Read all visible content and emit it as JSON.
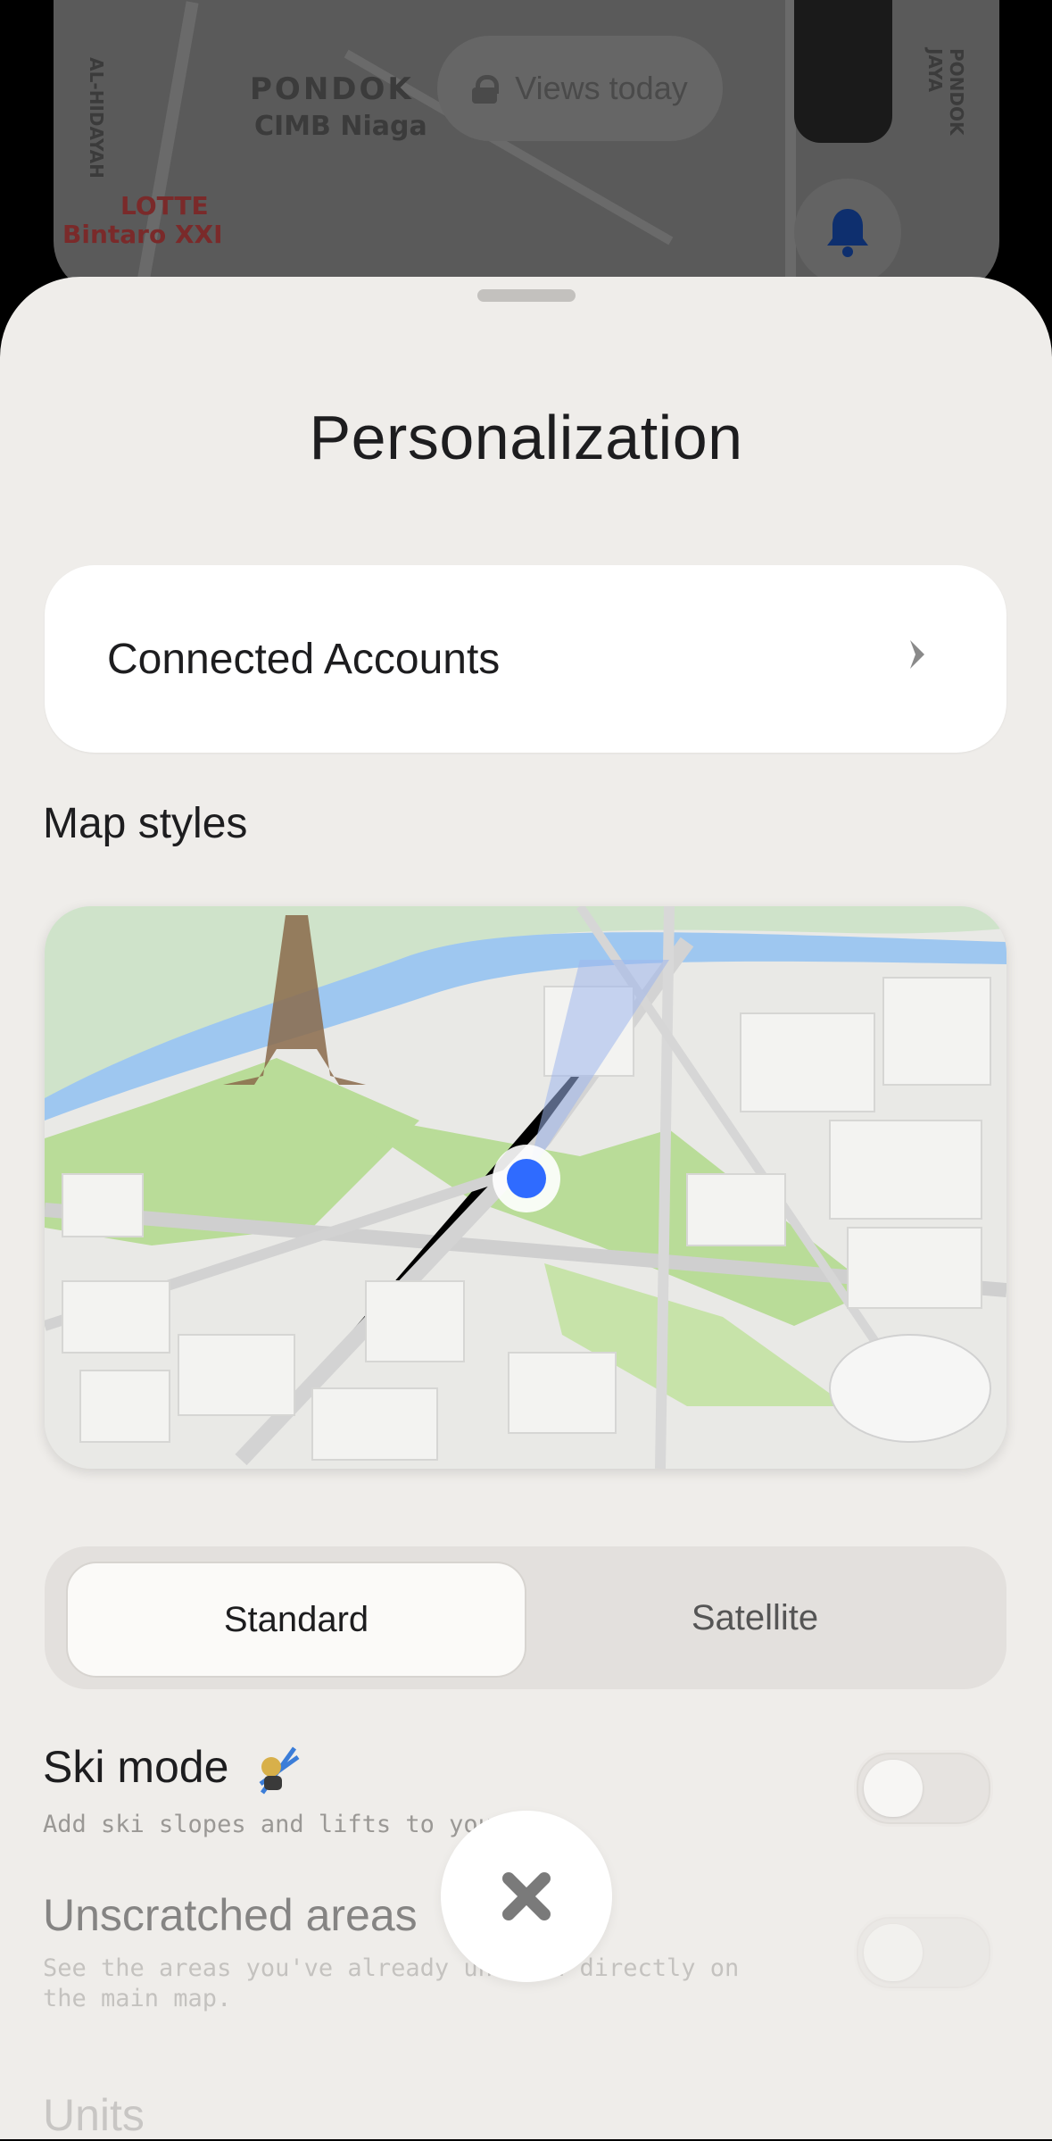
{
  "background_map": {
    "labels": [
      "PONDOK",
      "CIMB Niaga",
      "LOTTE",
      "Bintaro XXI",
      "AL-HIDAYAH",
      "PONDOK JAYA"
    ],
    "views_pill": "Views today"
  },
  "sheet": {
    "title": "Personalization",
    "connected_accounts_label": "Connected Accounts",
    "map_styles_title": "Map styles",
    "segments": {
      "standard": "Standard",
      "satellite": "Satellite",
      "selected": "Standard"
    },
    "settings": [
      {
        "name": "Ski mode",
        "description": "Add ski slopes and lifts to your",
        "enabled": false
      },
      {
        "name": "Unscratched areas",
        "description": "See the areas you've already unce    ed directly on the main map.",
        "enabled": false
      }
    ],
    "units_title": "Units"
  },
  "colors": {
    "accent": "#2f6bff",
    "sheet_bg": "#efedea"
  },
  "icons": {
    "chevron": "chevron-right-icon",
    "close": "close-icon",
    "bell": "bell-icon",
    "lock": "lock-icon"
  }
}
